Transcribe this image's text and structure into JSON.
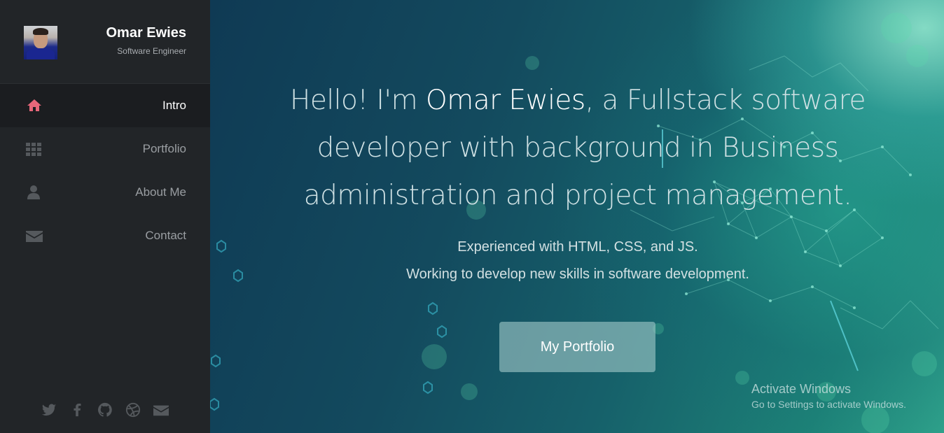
{
  "profile": {
    "name": "Omar Ewies",
    "role": "Software Engineer"
  },
  "nav": {
    "items": [
      {
        "label": "Intro",
        "icon": "home-icon",
        "active": true
      },
      {
        "label": "Portfolio",
        "icon": "grid-icon",
        "active": false
      },
      {
        "label": "About Me",
        "icon": "user-icon",
        "active": false
      },
      {
        "label": "Contact",
        "icon": "envelope-icon",
        "active": false
      }
    ]
  },
  "social": [
    "twitter-icon",
    "facebook-icon",
    "github-icon",
    "dribbble-icon",
    "envelope-icon"
  ],
  "hero": {
    "headline_pre": "Hello! I'm ",
    "headline_name": "Omar Ewies",
    "headline_post": ", a Fullstack software developer with background in Business administration and project management.",
    "line1": "Experienced with HTML, CSS, and JS.",
    "line2": "Working to develop new skills in software development.",
    "cta_label": "My Portfolio"
  },
  "watermark": {
    "title": "Activate Windows",
    "subtitle": "Go to Settings to activate Windows."
  },
  "colors": {
    "sidebar_bg": "#222528",
    "active_item_bg": "#1b1d20",
    "accent_home": "#e8677a",
    "icon_muted": "#5f6367"
  }
}
